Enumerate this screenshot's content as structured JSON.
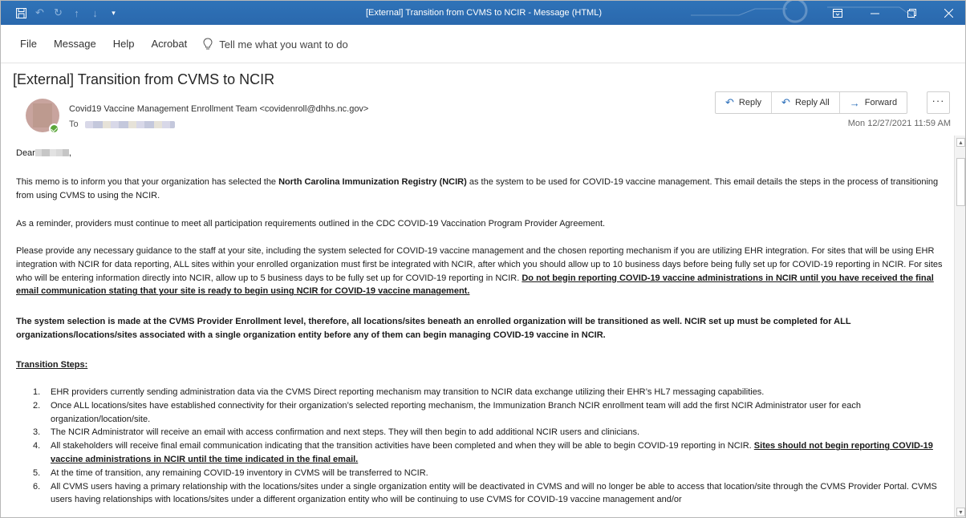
{
  "window": {
    "title": "[External] Transition from CVMS to NCIR  -  Message (HTML)",
    "qat_icons": [
      "save-icon",
      "undo-icon",
      "redo-icon",
      "up-arrow-icon",
      "down-arrow-icon",
      "customize-qat-icon"
    ],
    "controls": [
      "ribbon-display-icon",
      "minimize-icon",
      "restore-icon",
      "close-icon"
    ]
  },
  "menu": {
    "items": [
      "File",
      "Message",
      "Help",
      "Acrobat"
    ],
    "tell_me": "Tell me what you want to do"
  },
  "message": {
    "subject": "[External] Transition from CVMS to NCIR",
    "sender": "Covid19 Vaccine Management Enrollment Team <covidenroll@dhhs.nc.gov>",
    "to_label": "To",
    "date": "Mon 12/27/2021 11:59 AM"
  },
  "actions": {
    "reply": "Reply",
    "reply_all": "Reply All",
    "forward": "Forward",
    "more": "···"
  },
  "body": {
    "greeting_prefix": "Dear",
    "greeting_suffix": ",",
    "p1_a": "This memo is to inform you that your organization has selected the ",
    "p1_b": "North Carolina Immunization Registry (NCIR)",
    "p1_c": " as the system to be used for COVID-19 vaccine management. This email details the steps in the process of transitioning from using CVMS to using the NCIR.",
    "p2": "As a reminder, providers must continue to meet all participation requirements outlined in the CDC COVID-19 Vaccination Program Provider Agreement.",
    "p3_a": "Please provide any necessary guidance to the staff at your site, including the system selected for COVID-19 vaccine management and the chosen reporting mechanism if you are utilizing EHR integration. For sites that will be using EHR integration with NCIR for data reporting, ALL sites within your enrolled organization must first be integrated with NCIR, after which you should allow up to 10 business days before being fully set up for COVID-19 reporting in NCIR. For sites who will be entering information directly into NCIR, allow up to 5 business days to be fully set up for COVID-19 reporting in NCIR. ",
    "p3_b": "Do not begin reporting COVID-19 vaccine administrations in NCIR until you have received the final email communication stating that your site is ready to begin using NCIR for COVID-19 vaccine management.",
    "p4": "The system selection is made at the CVMS Provider Enrollment level, therefore, all locations/sites beneath an enrolled organization will be transitioned as well. NCIR set up must be completed for ALL organizations/locations/sites associated with a single organization entity before any of them can begin managing COVID-19 vaccine in NCIR.",
    "steps_heading": "Transition Steps:",
    "steps": [
      {
        "num": "1.",
        "text": "EHR providers currently sending administration data via the CVMS Direct reporting mechanism may transition to NCIR data exchange utilizing their EHR’s HL7 messaging capabilities."
      },
      {
        "num": "2.",
        "text": "Once ALL locations/sites have established connectivity for their organization’s selected reporting mechanism, the Immunization Branch NCIR enrollment team will add the first NCIR Administrator user for each organization/location/site."
      },
      {
        "num": "3.",
        "text": "The NCIR Administrator will receive an email with access confirmation and next steps. They will then begin to add additional NCIR users and clinicians."
      },
      {
        "num": "4.",
        "text": "All stakeholders will receive final email communication indicating that the transition activities have been completed and when they will be able to begin COVID-19 reporting in NCIR. ",
        "emph": "Sites should not begin reporting COVID-19 vaccine administrations in NCIR until the time indicated in the final email."
      },
      {
        "num": "5.",
        "text": "At the time of transition, any remaining COVID-19 inventory in CVMS will be transferred to NCIR."
      },
      {
        "num": "6.",
        "text": "All CVMS users having a primary relationship with the locations/sites under a single organization entity will be deactivated in CVMS and will no longer be able to access that location/site through the CVMS Provider Portal. CVMS users having relationships with locations/sites under a different organization entity who will be continuing to use CVMS for COVID-19 vaccine management and/or"
      }
    ]
  },
  "colors": {
    "titlebar": "#2b6cb0",
    "accent": "#2c6fba",
    "presence": "#5ba63a"
  }
}
